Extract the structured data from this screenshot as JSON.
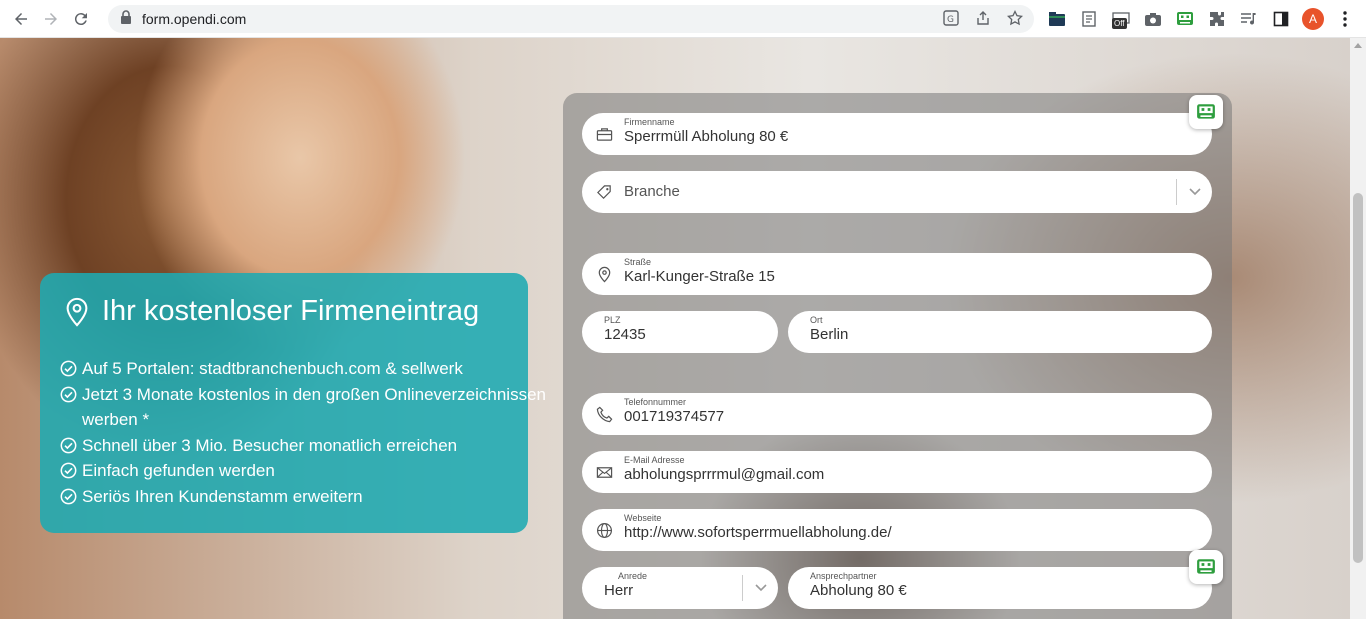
{
  "browser": {
    "url": "form.opendi.com",
    "profile_initial": "A",
    "ext_badge": "Off"
  },
  "info": {
    "title": "Ihr kostenloser Firmeneintrag",
    "items": [
      "Auf 5 Portalen: stadtbranchenbuch.com & sellwerk",
      "Jetzt 3 Monate kostenlos in den großen Onlineverzeichnissen werben *",
      "Schnell über 3 Mio. Besucher monatlich erreichen",
      "Einfach gefunden werden",
      "Seriös Ihren Kundenstamm erweitern"
    ]
  },
  "form": {
    "firmenname": {
      "label": "Firmenname",
      "value": "Sperrmüll Abholung 80 €"
    },
    "branche": {
      "placeholder": "Branche"
    },
    "strasse": {
      "label": "Straße",
      "value": "Karl-Kunger-Straße 15"
    },
    "plz": {
      "label": "PLZ",
      "value": "12435"
    },
    "ort": {
      "label": "Ort",
      "value": "Berlin"
    },
    "telefon": {
      "label": "Telefonnummer",
      "value": "001719374577"
    },
    "email": {
      "label": "E-Mail Adresse",
      "value": "abholungsprrrmul@gmail.com"
    },
    "webseite": {
      "label": "Webseite",
      "value": "http://www.sofortsperrmuellabholung.de/"
    },
    "anrede": {
      "label": "Anrede",
      "value": "Herr"
    },
    "ansprechpartner": {
      "label": "Ansprechpartner",
      "value": "Abholung 80 €"
    }
  },
  "colors": {
    "teal": "#1eaab2",
    "bot_green": "#2e9e3e"
  }
}
